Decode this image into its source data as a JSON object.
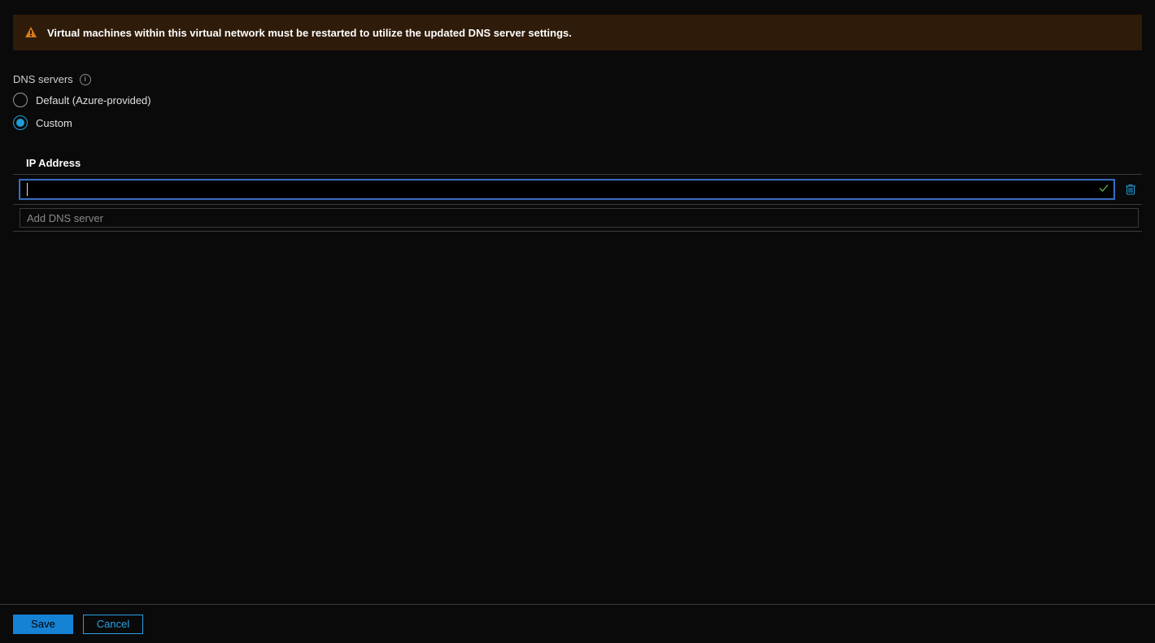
{
  "warning": {
    "message": "Virtual machines within this virtual network must be restarted to utilize the updated DNS server settings."
  },
  "dns": {
    "section_label": "DNS servers",
    "options": {
      "default_label": "Default (Azure-provided)",
      "custom_label": "Custom",
      "selected": "custom"
    },
    "column_header": "IP Address",
    "rows": [
      {
        "value": ""
      }
    ],
    "add_placeholder": "Add DNS server"
  },
  "footer": {
    "save_label": "Save",
    "cancel_label": "Cancel"
  }
}
